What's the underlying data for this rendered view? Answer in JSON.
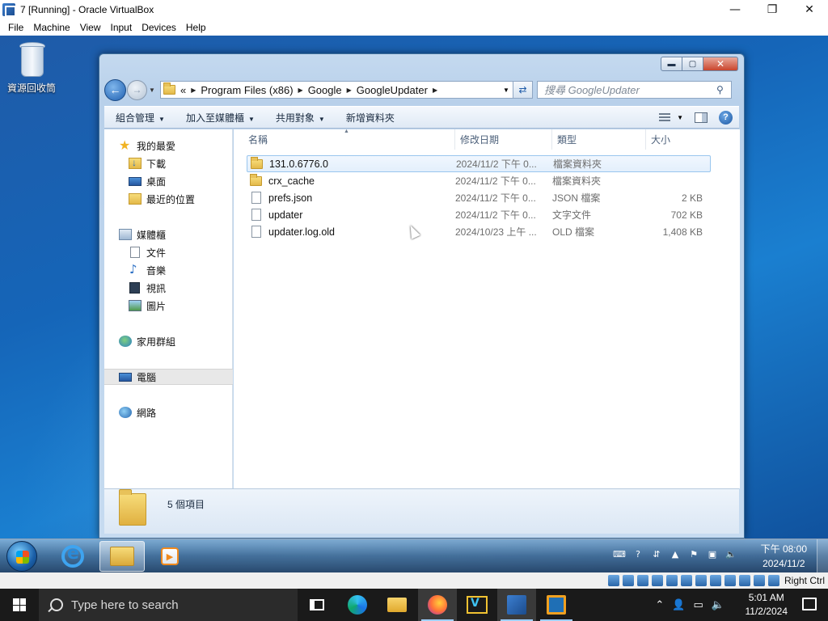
{
  "vbox": {
    "title": "7 [Running] - Oracle VirtualBox",
    "menu": [
      "File",
      "Machine",
      "View",
      "Input",
      "Devices",
      "Help"
    ],
    "window_controls": {
      "minimize": "—",
      "maximize": "❐",
      "close": "✕"
    },
    "host_key": "Right Ctrl"
  },
  "desktop": {
    "recycle_bin_label": "資源回收筒"
  },
  "explorer": {
    "window_controls": {
      "minimize": "▬",
      "maximize": "▢",
      "close": "✕"
    },
    "breadcrumb": {
      "overflow": "«",
      "parts": [
        "Program Files (x86)",
        "Google",
        "GoogleUpdater"
      ]
    },
    "search_placeholder": "搜尋 GoogleUpdater",
    "toolbar": {
      "organize": "組合管理",
      "include_in_library": "加入至媒體櫃",
      "share_with": "共用對象",
      "new_folder": "新增資料夾"
    },
    "nav": {
      "favorites": "我的最愛",
      "downloads": "下載",
      "desktop": "桌面",
      "recent": "最近的位置",
      "libraries": "媒體櫃",
      "documents": "文件",
      "music": "音樂",
      "videos": "視訊",
      "pictures": "圖片",
      "homegroup": "家用群組",
      "computer": "電腦",
      "network": "網路"
    },
    "columns": {
      "name": "名稱",
      "date_modified": "修改日期",
      "type": "類型",
      "size": "大小"
    },
    "files": [
      {
        "name": "131.0.6776.0",
        "date": "2024/11/2 下午 0...",
        "type": "檔案資料夾",
        "size": "",
        "icon": "folder-icon",
        "selected": true
      },
      {
        "name": "crx_cache",
        "date": "2024/11/2 下午 0...",
        "type": "檔案資料夾",
        "size": "",
        "icon": "folder-icon",
        "selected": false
      },
      {
        "name": "prefs.json",
        "date": "2024/11/2 下午 0...",
        "type": "JSON 檔案",
        "size": "2 KB",
        "icon": "file-icon",
        "selected": false
      },
      {
        "name": "updater",
        "date": "2024/11/2 下午 0...",
        "type": "文字文件",
        "size": "702 KB",
        "icon": "file-icon",
        "selected": false
      },
      {
        "name": "updater.log.old",
        "date": "2024/10/23 上午 ...",
        "type": "OLD 檔案",
        "size": "1,408 KB",
        "icon": "file-icon",
        "selected": false
      }
    ],
    "item_count": "5 個項目"
  },
  "guest_taskbar": {
    "clock_time": "下午 08:00",
    "clock_date": "2024/11/2"
  },
  "host_taskbar": {
    "search_placeholder": "Type here to search",
    "clock_time": "5:01 AM",
    "clock_date": "11/2/2024"
  }
}
